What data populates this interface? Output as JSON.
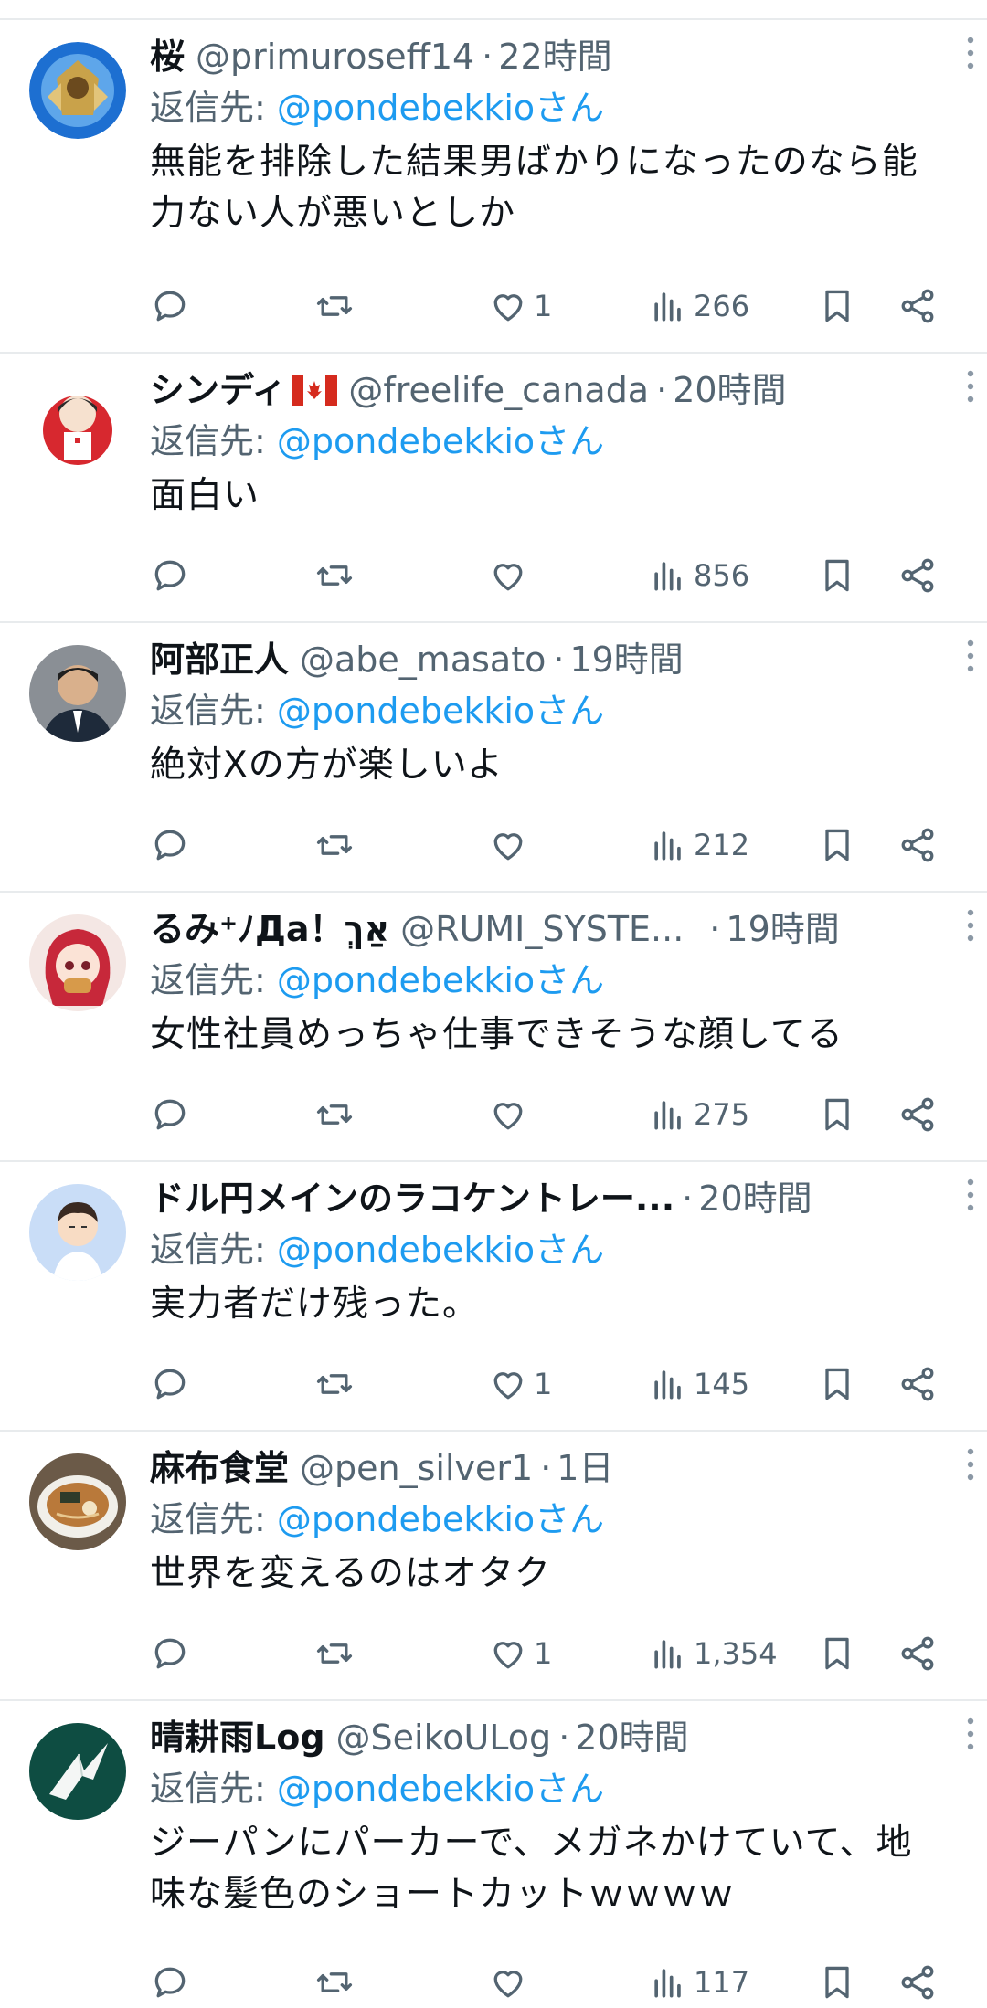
{
  "reply_prefix": "返信先: ",
  "reply_suffix": "",
  "tweets": [
    {
      "name": "桜",
      "handle": "@primuroseff14",
      "dot": "·",
      "time": "22時間",
      "reply_to": "@pondebekkioさん",
      "text_lines": [
        "無能を排除した結果男ばかりになったのなら能",
        "力ない人が悪いとしか"
      ],
      "likes": "1",
      "views": "266"
    },
    {
      "name": "シンディ",
      "handle": "@freelife_canada",
      "dot": "·",
      "time": "20時間",
      "reply_to": "@pondebekkioさん",
      "text_lines": [
        "面白い"
      ],
      "likes": "",
      "views": "856"
    },
    {
      "name": "阿部正人",
      "handle": "@abe_masato",
      "dot": "·",
      "time": "19時間",
      "reply_to": "@pondebekkioさん",
      "text_lines": [
        "絶対Xの方が楽しいよ"
      ],
      "likes": "",
      "views": "212"
    },
    {
      "name": "るみ⁺ﾉДa！אַךְ",
      "handle": "@RUMI_SYSTE...",
      "dot": "·",
      "time": "19時間",
      "reply_to": "@pondebekkioさん",
      "text_lines": [
        "女性社員めっちゃ仕事できそうな顔してる"
      ],
      "likes": "",
      "views": "275"
    },
    {
      "name": "ドル円メインのラコケントレー...",
      "handle": "",
      "dot": "·",
      "time": "20時間",
      "reply_to": "@pondebekkioさん",
      "text_lines": [
        "実力者だけ残った。"
      ],
      "likes": "1",
      "views": "145"
    },
    {
      "name": "麻布食堂",
      "handle": "@pen_silver1",
      "dot": "·",
      "time": "1日",
      "reply_to": "@pondebekkioさん",
      "text_lines": [
        "世界を変えるのはオタク"
      ],
      "likes": "1",
      "views": "1,354"
    },
    {
      "name": "晴耕雨Log",
      "handle": "@SeikoULog",
      "dot": "·",
      "time": "20時間",
      "reply_to": "@pondebekkioさん",
      "text_lines": [
        "ジーパンにパーカーで、メガネかけていて、地",
        "味な髪色のショートカットｗｗｗｗ"
      ],
      "likes": "",
      "views": "117"
    }
  ],
  "colors": {
    "text": "#0f1419",
    "secondary": "#536471",
    "mention": "#1d9bf0",
    "divider": "#e8ebed"
  },
  "icons": [
    "reply-icon",
    "retweet-icon",
    "like-icon",
    "views-icon",
    "bookmark-icon",
    "share-icon",
    "more-icon",
    "canada-flag-icon"
  ]
}
